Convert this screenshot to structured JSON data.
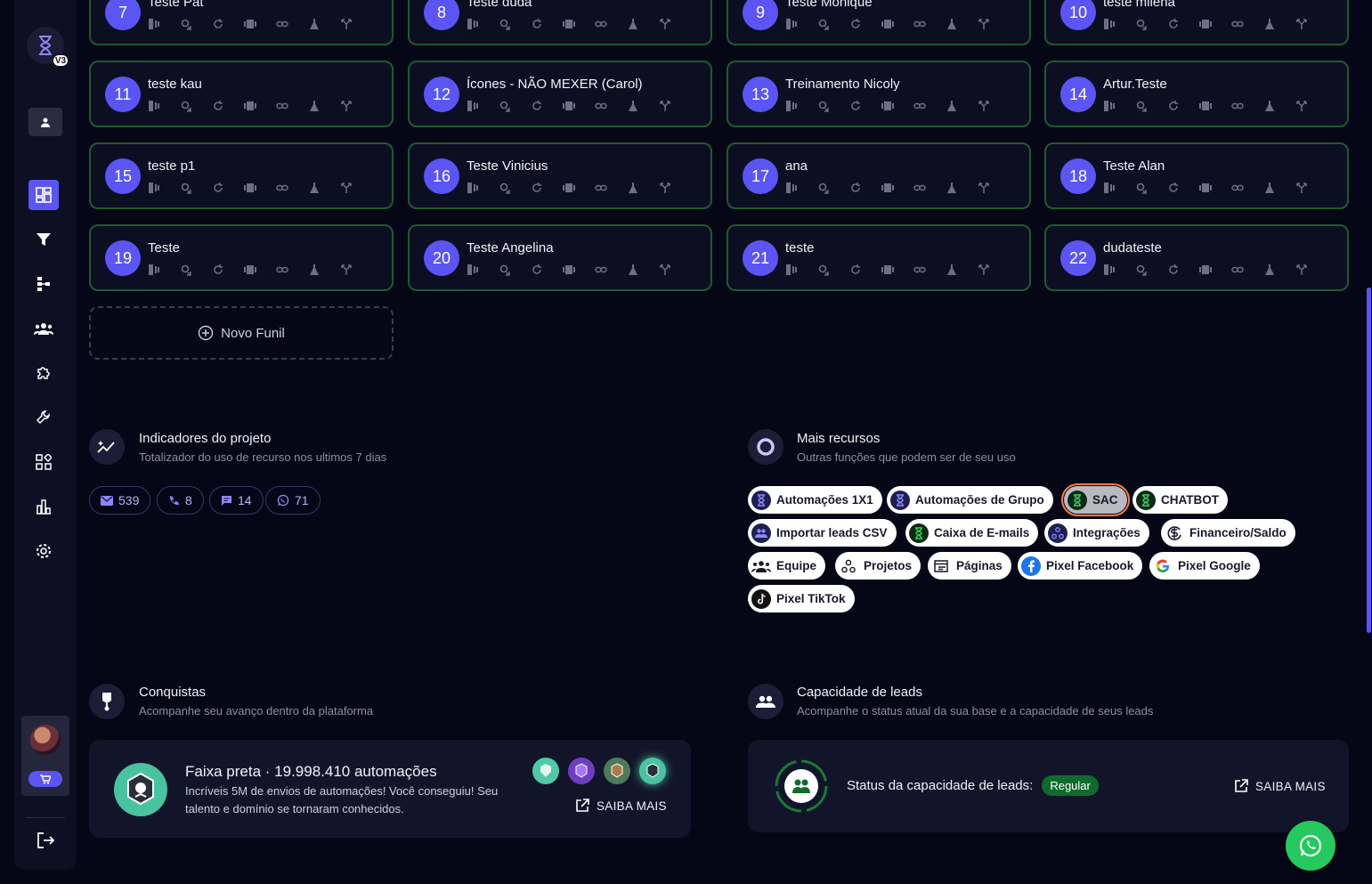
{
  "sidebar": {
    "logo_badge": "V3",
    "nav_icons": [
      "dashboard-icon",
      "funnel-icon",
      "flow-icon",
      "team-icon",
      "puzzle-icon",
      "wrench-icon",
      "apps-icon",
      "chart-icon",
      "settings-icon"
    ]
  },
  "funnels": [
    {
      "num": "7",
      "name": "Teste Pat"
    },
    {
      "num": "8",
      "name": "Teste duda"
    },
    {
      "num": "9",
      "name": "Teste Monique"
    },
    {
      "num": "10",
      "name": "teste milena"
    },
    {
      "num": "11",
      "name": "teste kau"
    },
    {
      "num": "12",
      "name": "Ícones - NÃO MEXER (Carol)"
    },
    {
      "num": "13",
      "name": "Treinamento Nicoly"
    },
    {
      "num": "14",
      "name": "Artur.Teste"
    },
    {
      "num": "15",
      "name": "teste p1"
    },
    {
      "num": "16",
      "name": "Teste Vinicius"
    },
    {
      "num": "17",
      "name": "ana"
    },
    {
      "num": "18",
      "name": "Teste Alan"
    },
    {
      "num": "19",
      "name": "Teste"
    },
    {
      "num": "20",
      "name": "Teste Angelina"
    },
    {
      "num": "21",
      "name": "teste"
    },
    {
      "num": "22",
      "name": "dudateste"
    }
  ],
  "new_funnel_label": "Novo Funil",
  "indicators": {
    "title": "Indicadores do projeto",
    "subtitle": "Totalizador do uso de recurso nos ultimos 7 dias",
    "stats": [
      {
        "icon": "mail-icon",
        "value": "539"
      },
      {
        "icon": "phone-icon",
        "value": "8"
      },
      {
        "icon": "chat-icon",
        "value": "14"
      },
      {
        "icon": "whatsapp-icon",
        "value": "71"
      }
    ]
  },
  "resources": {
    "title": "Mais recursos",
    "subtitle": "Outras funções que podem ser de seu uso",
    "items": [
      {
        "label": "Automações 1X1",
        "icon": "hourglass-icon"
      },
      {
        "label": "Automações de Grupo",
        "icon": "hourglass-icon"
      },
      {
        "label": "SAC",
        "icon": "hourglass-green-icon",
        "selected": true
      },
      {
        "label": "CHATBOT",
        "icon": "hourglass-green-icon"
      },
      {
        "label": "Importar leads CSV",
        "icon": "people-icon"
      },
      {
        "label": "Caixa de E-mails",
        "icon": "hourglass-green-icon"
      },
      {
        "label": "Integrações",
        "icon": "integration-icon"
      },
      {
        "label": "Financeiro/Saldo",
        "icon": "money-icon"
      },
      {
        "label": "Equipe",
        "icon": "team-icon"
      },
      {
        "label": "Projetos",
        "icon": "projects-icon"
      },
      {
        "label": "Páginas",
        "icon": "pages-icon"
      },
      {
        "label": "Pixel Facebook",
        "icon": "facebook-icon"
      },
      {
        "label": "Pixel Google",
        "icon": "google-icon"
      },
      {
        "label": "Pixel TikTok",
        "icon": "tiktok-icon"
      }
    ]
  },
  "achievements": {
    "title": "Conquistas",
    "subtitle": "Acompanhe seu avanço dentro da plataforma",
    "belt": "Faixa preta",
    "count": "· 19.998.410 automações",
    "description": "Incríveis 5M de envios de automações! Você conseguiu! Seu talento e domínio se tornaram conhecidos.",
    "saiba_mais": "SAIBA MAIS"
  },
  "capacity": {
    "title": "Capacidade de leads",
    "subtitle": "Acompanhe o status atual da sua base e a capacidade de seus leads",
    "status_label": "Status da capacidade de leads:",
    "status_value": "Regular",
    "saiba_mais": "SAIBA MAIS"
  },
  "colors": {
    "accent": "#5b55f5",
    "card_border": "#1f5a2e",
    "background": "#050716",
    "success": "#0f6b2c",
    "whatsapp": "#25c95f"
  }
}
